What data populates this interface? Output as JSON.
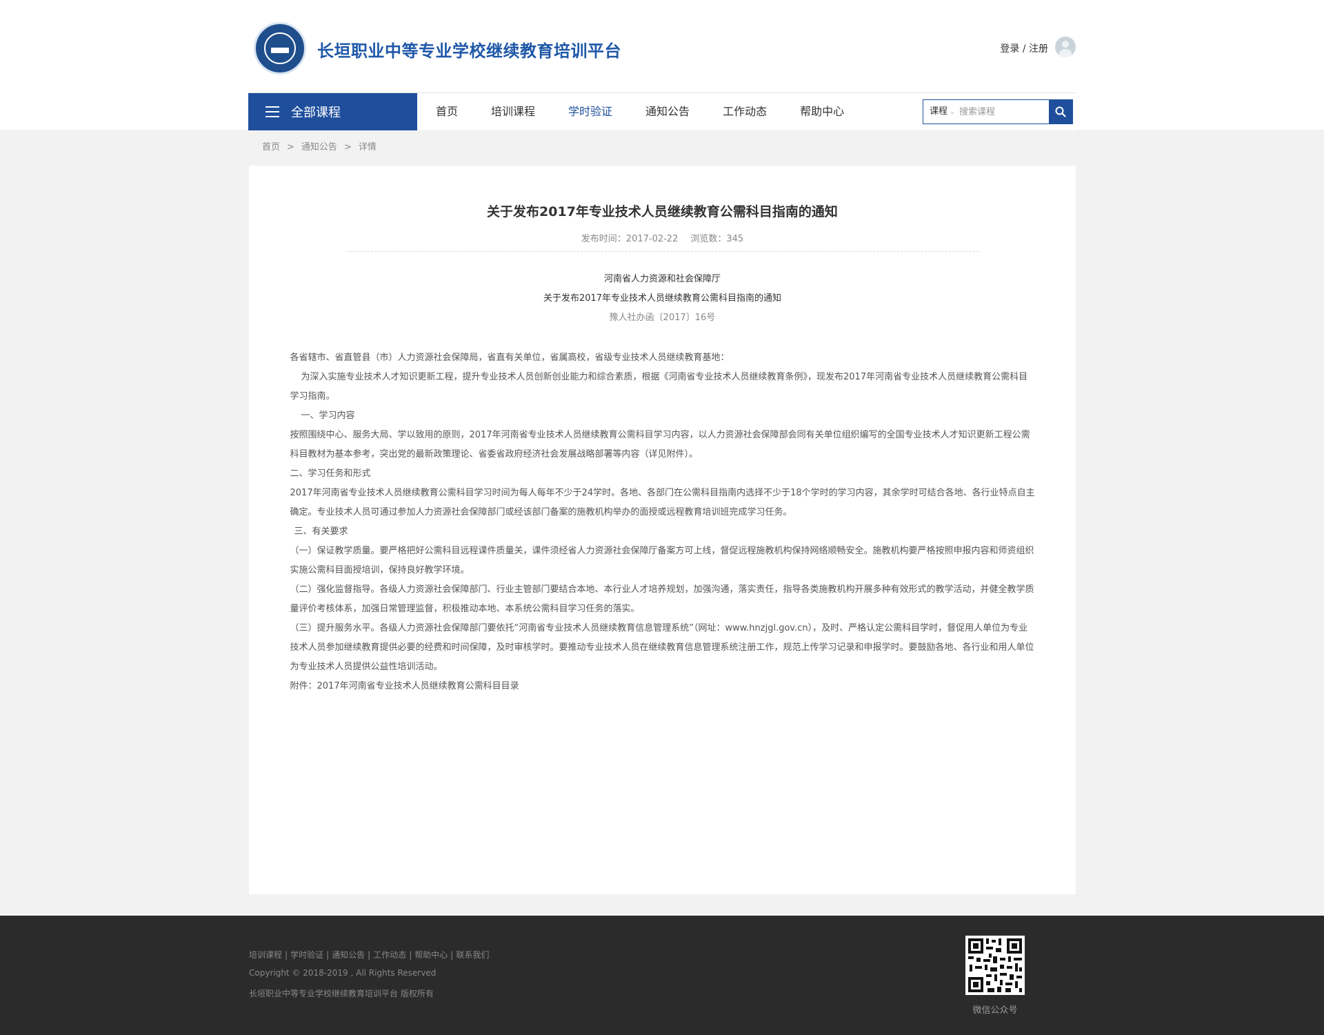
{
  "header": {
    "site_title": "长垣职业中等专业学校继续教育培训平台",
    "login_register": "登录 / 注册"
  },
  "nav": {
    "all_courses": "全部课程",
    "items": [
      "首页",
      "培训课程",
      "学时验证",
      "通知公告",
      "工作动态",
      "帮助中心"
    ],
    "active_item": "学时验证"
  },
  "search": {
    "type": "课程",
    "placeholder": "搜索课程"
  },
  "breadcrumb": [
    "首页",
    "通知公告",
    "详情"
  ],
  "breadcrumb_sep": ">",
  "article": {
    "title": "关于发布2017年专业技术人员继续教育公需科目指南的通知",
    "publish_time": "发布时间：2017-02-22",
    "views": "浏览数：345",
    "issuer": "河南省人力资源和社会保障厅",
    "doc_title": "关于发布2017年专业技术人员继续教育公需科目指南的通知",
    "doc_number": "豫人社办函〔2017〕16号",
    "paragraphs": [
      "各省辖市、省直管县（市）人力资源社会保障局，省直有关单位，省属高校，省级专业技术人员继续教育基地：",
      "为深入实施专业技术人才知识更新工程，提升专业技术人员创新创业能力和综合素质，根据《河南省专业技术人员继续教育条例》，现发布2017年河南省专业技术人员继续教育公需科目学习指南。",
      "一、学习内容",
      "按照围绕中心、服务大局、学以致用的原则，2017年河南省专业技术人员继续教育公需科目学习内容，以人力资源社会保障部会同有关单位组织编写的全国专业技术人才知识更新工程公需科目教材为基本参考，突出党的最新政策理论、省委省政府经济社会发展战略部署等内容（详见附件）。",
      "二、学习任务和形式",
      "2017年河南省专业技术人员继续教育公需科目学习时间为每人每年不少于24学时。各地、各部门在公需科目指南内选择不少于18个学时的学习内容，其余学时可结合各地、各行业特点自主确定。专业技术人员可通过参加人力资源社会保障部门或经该部门备案的施教机构举办的面授或远程教育培训班完成学习任务。",
      "三、有关要求",
      "（一）保证教学质量。要严格把好公需科目远程课件质量关，课件须经省人力资源社会保障厅备案方可上线，督促远程施教机构保持网络顺畅安全。施教机构要严格按照申报内容和师资组织实施公需科目面授培训，保持良好教学环境。",
      "（二）强化监督指导。各级人力资源社会保障部门、行业主管部门要结合本地、本行业人才培养规划，加强沟通，落实责任，指导各类施教机构开展多种有效形式的教学活动，并健全教学质量评价考核体系，加强日常管理监督，积极推动本地、本系统公需科目学习任务的落实。",
      "（三）提升服务水平。各级人力资源社会保障部门要依托“河南省专业技术人员继续教育信息管理系统”（网址：www.hnzjgl.gov.cn），及时、严格认定公需科目学时，督促用人单位为专业技术人员参加继续教育提供必要的经费和时间保障，及时审核学时。要推动专业技术人员在继续教育信息管理系统注册工作，规范上传学习记录和申报学时。要鼓励各地、各行业和用人单位为专业技术人员提供公益性培训活动。",
      "附件：2017年河南省专业技术人员继续教育公需科目目录"
    ]
  },
  "footer": {
    "links": [
      "培训课程",
      "学时验证",
      "通知公告",
      "工作动态",
      "帮助中心",
      "联系我们"
    ],
    "copyright": "Copyright © 2018-2019 , All Rights Reserved",
    "rights": "长垣职业中等专业学校继续教育培训平台  版权所有",
    "qr_label": "微信公众号"
  },
  "colors": {
    "brand_blue": "#1f4f9c",
    "footer_bg": "#2b2b2b"
  },
  "icons": [
    "school-logo-icon",
    "user-avatar-icon",
    "menu-icon",
    "search-icon",
    "qr-code"
  ]
}
